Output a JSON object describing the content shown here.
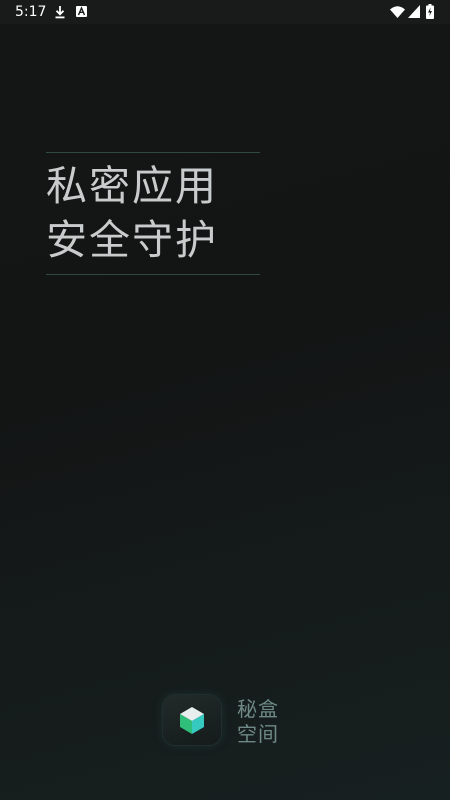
{
  "status_bar": {
    "time": "5:17",
    "icons": [
      "download-icon",
      "a-icon",
      "wifi-icon",
      "signal-icon",
      "battery-charging-icon"
    ]
  },
  "slogan": {
    "line1": "私密应用",
    "line2": "安全守护"
  },
  "brand": {
    "line1": "秘盒",
    "line2": "空间"
  },
  "colors": {
    "background": "#131515",
    "divider": "#2f4a44",
    "slogan_text": "#c9cccc",
    "brand_text": "#6f8a86",
    "accent_green": "#2fbf7a",
    "accent_teal": "#35c9c0"
  }
}
